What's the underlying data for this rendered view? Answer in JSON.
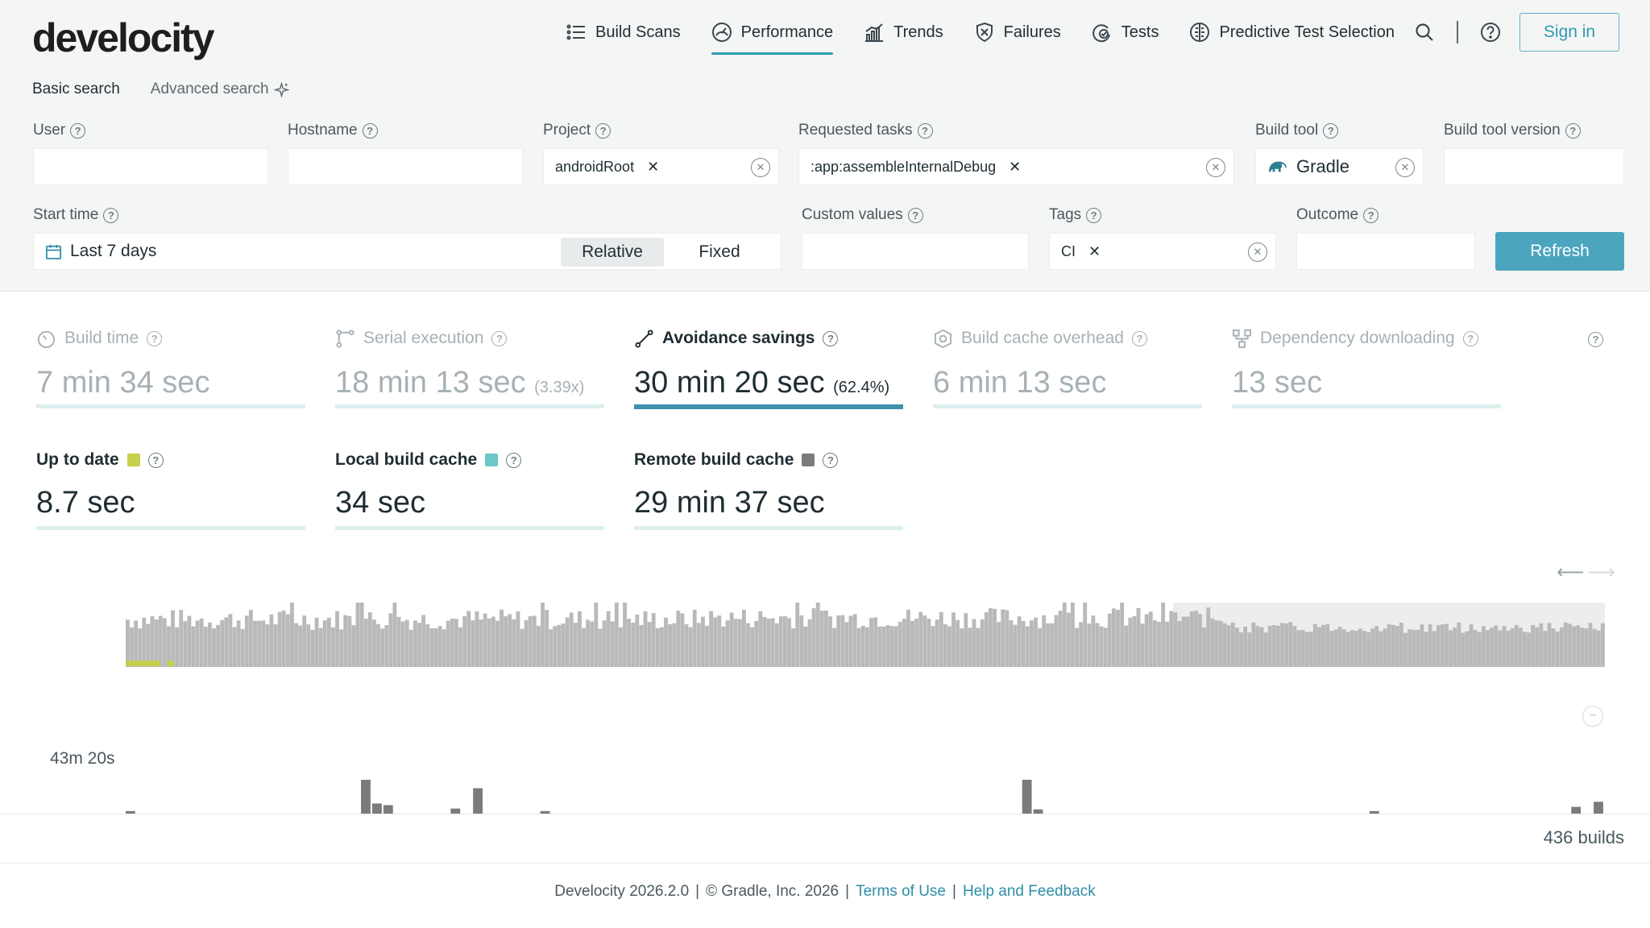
{
  "app": {
    "logo": "develocity"
  },
  "nav": {
    "items": [
      {
        "label": "Build Scans",
        "icon": "list-icon"
      },
      {
        "label": "Performance",
        "icon": "speedometer-icon",
        "active": true
      },
      {
        "label": "Trends",
        "icon": "bar-chart-icon"
      },
      {
        "label": "Failures",
        "icon": "shield-x-icon"
      },
      {
        "label": "Tests",
        "icon": "test-icon"
      },
      {
        "label": "Predictive Test Selection",
        "icon": "brain-icon"
      }
    ],
    "signin": "Sign in"
  },
  "search": {
    "basic": "Basic search",
    "advanced": "Advanced search",
    "fields": {
      "user": {
        "label": "User"
      },
      "hostname": {
        "label": "Hostname"
      },
      "project": {
        "label": "Project",
        "chip": "androidRoot"
      },
      "tasks": {
        "label": "Requested tasks",
        "chip": ":app:assembleInternalDebug"
      },
      "buildtool": {
        "label": "Build tool",
        "value": "Gradle"
      },
      "buildtoolversion": {
        "label": "Build tool version"
      },
      "starttime": {
        "label": "Start time",
        "value": "Last 7 days",
        "relative": "Relative",
        "fixed": "Fixed"
      },
      "custom": {
        "label": "Custom values"
      },
      "tags": {
        "label": "Tags",
        "chip": "CI"
      },
      "outcome": {
        "label": "Outcome"
      }
    },
    "refresh": "Refresh"
  },
  "metrics": {
    "build_time": {
      "label": "Build time",
      "value": "7 min 34 sec"
    },
    "serial": {
      "label": "Serial execution",
      "value": "18 min 13 sec",
      "extra": "(3.39x)"
    },
    "avoidance": {
      "label": "Avoidance savings",
      "value": "30 min 20 sec",
      "extra": "(62.4%)"
    },
    "cache_overhead": {
      "label": "Build cache overhead",
      "value": "6 min 13 sec"
    },
    "dependency": {
      "label": "Dependency downloading",
      "value": "13 sec"
    }
  },
  "breakdown": {
    "up_to_date": {
      "label": "Up to date",
      "value": "8.7 sec",
      "color": "#c5d04d"
    },
    "local_cache": {
      "label": "Local build cache",
      "value": "34 sec",
      "color": "#6cc7c7"
    },
    "remote_cache": {
      "label": "Remote build cache",
      "value": "29 min 37 sec",
      "color": "#7b7b7b"
    }
  },
  "chart": {
    "ymax_label": "43m 20s"
  },
  "builds_count": "436 builds",
  "footer": {
    "version": "Develocity 2026.2.0",
    "copyright": "© Gradle, Inc. 2026",
    "terms": "Terms of Use",
    "help": "Help and Feedback"
  },
  "chart_data": {
    "type": "bar",
    "title": "",
    "ylabel": "",
    "ylim": [
      0,
      2600
    ],
    "y_tick_labels": [
      "43m 20s"
    ],
    "detail_series": {
      "name": "",
      "values": [
        3,
        0,
        0,
        0,
        0,
        0,
        0,
        0,
        0,
        0,
        0,
        0,
        0,
        0,
        0,
        0,
        0,
        0,
        0,
        0,
        0,
        40,
        12,
        10,
        0,
        0,
        0,
        0,
        0,
        6,
        0,
        30,
        0,
        0,
        0,
        0,
        0,
        3,
        0,
        0,
        0,
        0,
        0,
        0,
        0,
        0,
        0,
        0,
        0,
        0,
        0,
        0,
        0,
        0,
        0,
        0,
        0,
        0,
        0,
        0,
        0,
        0,
        0,
        0,
        0,
        0,
        0,
        0,
        0,
        0,
        0,
        0,
        0,
        0,
        0,
        0,
        0,
        0,
        0,
        0,
        40,
        5,
        0,
        0,
        0,
        0,
        0,
        0,
        0,
        0,
        0,
        0,
        0,
        0,
        0,
        0,
        0,
        0,
        0,
        0,
        0,
        0,
        0,
        0,
        0,
        0,
        0,
        0,
        0,
        0,
        0,
        3,
        0,
        0,
        0,
        0,
        0,
        0,
        0,
        0,
        0,
        0,
        0,
        0,
        0,
        0,
        0,
        0,
        0,
        8,
        0,
        14
      ]
    }
  }
}
